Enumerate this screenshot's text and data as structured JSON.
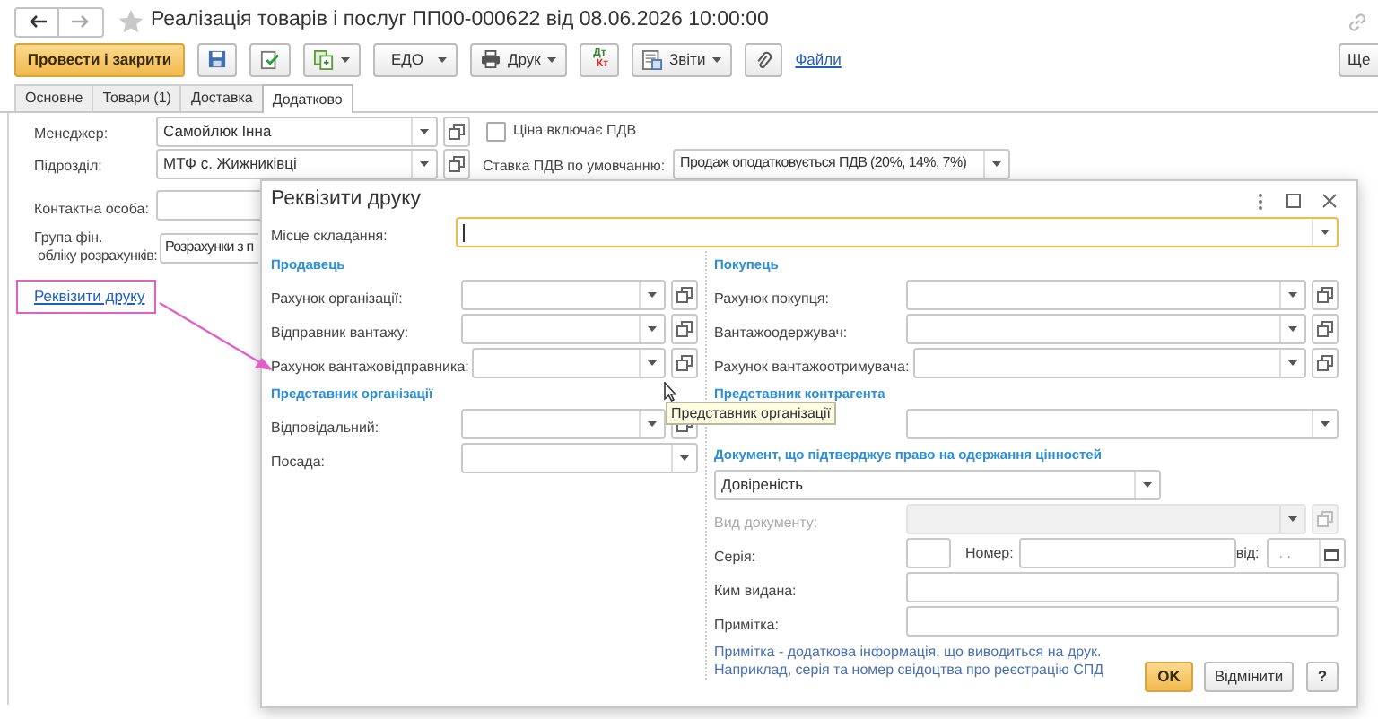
{
  "nav": {
    "back": {
      "disabled": false
    },
    "forward": {
      "disabled": true
    }
  },
  "title": "Реалізація товарів і послуг ПП00-000622 від 08.06.2026 10:00:00",
  "toolbar": [
    {
      "kind": "primary",
      "label": "Провести і закрити"
    },
    {
      "kind": "save"
    },
    {
      "kind": "post"
    },
    {
      "kind": "create",
      "menu": true
    },
    {
      "kind": "text",
      "label": "ЕДО",
      "menu": true
    },
    {
      "kind": "print",
      "label": "Друк",
      "menu": true
    },
    {
      "kind": "dtkt",
      "top": "Дт",
      "bottom": "Кт"
    },
    {
      "kind": "reports",
      "label": "Звіти",
      "menu": true
    },
    {
      "kind": "attach"
    },
    {
      "kind": "link",
      "label": "Файли"
    }
  ],
  "more": "Ще",
  "tabs": [
    {
      "label": "Основне",
      "selected": false
    },
    {
      "label": "Товари (1)",
      "selected": false
    },
    {
      "label": "Доставка",
      "selected": false
    },
    {
      "label": "Додатково",
      "selected": true
    }
  ],
  "form": {
    "manager": {
      "label": "Менеджер:",
      "value": "Самойлюк Інна"
    },
    "price_includes_vat": {
      "label": "Ціна включає ПДВ",
      "checked": false
    },
    "department": {
      "label": "Підрозділ:",
      "value": "МТФ с. Жижниківці"
    },
    "vat_rate": {
      "label": "Ставка ПДВ по умовчанню:",
      "value": "Продаж оподатковується ПДВ (20%, 14%, 7%)"
    },
    "contact": {
      "label": "Контактна особа:"
    },
    "group": {
      "label_lines": [
        "Група фін.",
        "обліку розрахунків:"
      ],
      "value": "Розрахунки з п"
    },
    "print_link": "Реквізити друку"
  },
  "dialog": {
    "title": "Реквізити друку",
    "place": {
      "label": "Місце складання:"
    },
    "left": [
      {
        "kind": "heading",
        "text": "Продавець"
      },
      {
        "kind": "field",
        "label": "Рахунок організації:",
        "open": true,
        "disabled": false
      },
      {
        "kind": "field",
        "label": "Відправник вантажу:",
        "open": true,
        "disabled": false
      },
      {
        "kind": "field",
        "label": "Рахунок вантажовідправника:",
        "open": true,
        "disabled": false
      },
      {
        "kind": "heading",
        "text": "Представник організації"
      },
      {
        "kind": "field",
        "label": "Відповідальний:",
        "open": true,
        "disabled": false
      },
      {
        "kind": "field",
        "label": "Посада:",
        "open": false,
        "disabled": false
      }
    ],
    "right": [
      {
        "kind": "heading",
        "text": "Покупець"
      },
      {
        "kind": "field",
        "label": "Рахунок покупця:",
        "open": true,
        "disabled": false
      },
      {
        "kind": "field",
        "label": "Вантажоодержувач:",
        "open": true,
        "disabled": false
      },
      {
        "kind": "field",
        "label": "Рахунок вантажоотримувача:",
        "open": true,
        "disabled": false
      },
      {
        "kind": "heading",
        "text": "Представник контрагента"
      },
      {
        "kind": "field",
        "open": false,
        "disabled": false
      },
      {
        "kind": "heading",
        "text": "Документ, що підтверджує право на одержання цінностей"
      },
      {
        "kind": "select",
        "value": "Довіреність"
      },
      {
        "kind": "field",
        "label": "Вид документу:",
        "open": true,
        "disabled": true
      },
      {
        "kind": "series",
        "label": "Серія:",
        "number_label": "Номер:",
        "date_label": "від:",
        "date_value": ". ."
      },
      {
        "kind": "text",
        "label": "Ким видана:"
      },
      {
        "kind": "text",
        "label": "Примітка:"
      },
      {
        "kind": "note",
        "text": "Примітка - додаткова інформація, що виводиться на друк. Наприклад, серія та номер свідоцтва про реєстрацію СПД"
      }
    ],
    "buttons": [
      {
        "kind": "default",
        "label": "OK"
      },
      {
        "kind": "plain",
        "label": "Відмінити"
      },
      {
        "kind": "help",
        "label": "?"
      }
    ]
  },
  "tooltip": "Представник організації"
}
